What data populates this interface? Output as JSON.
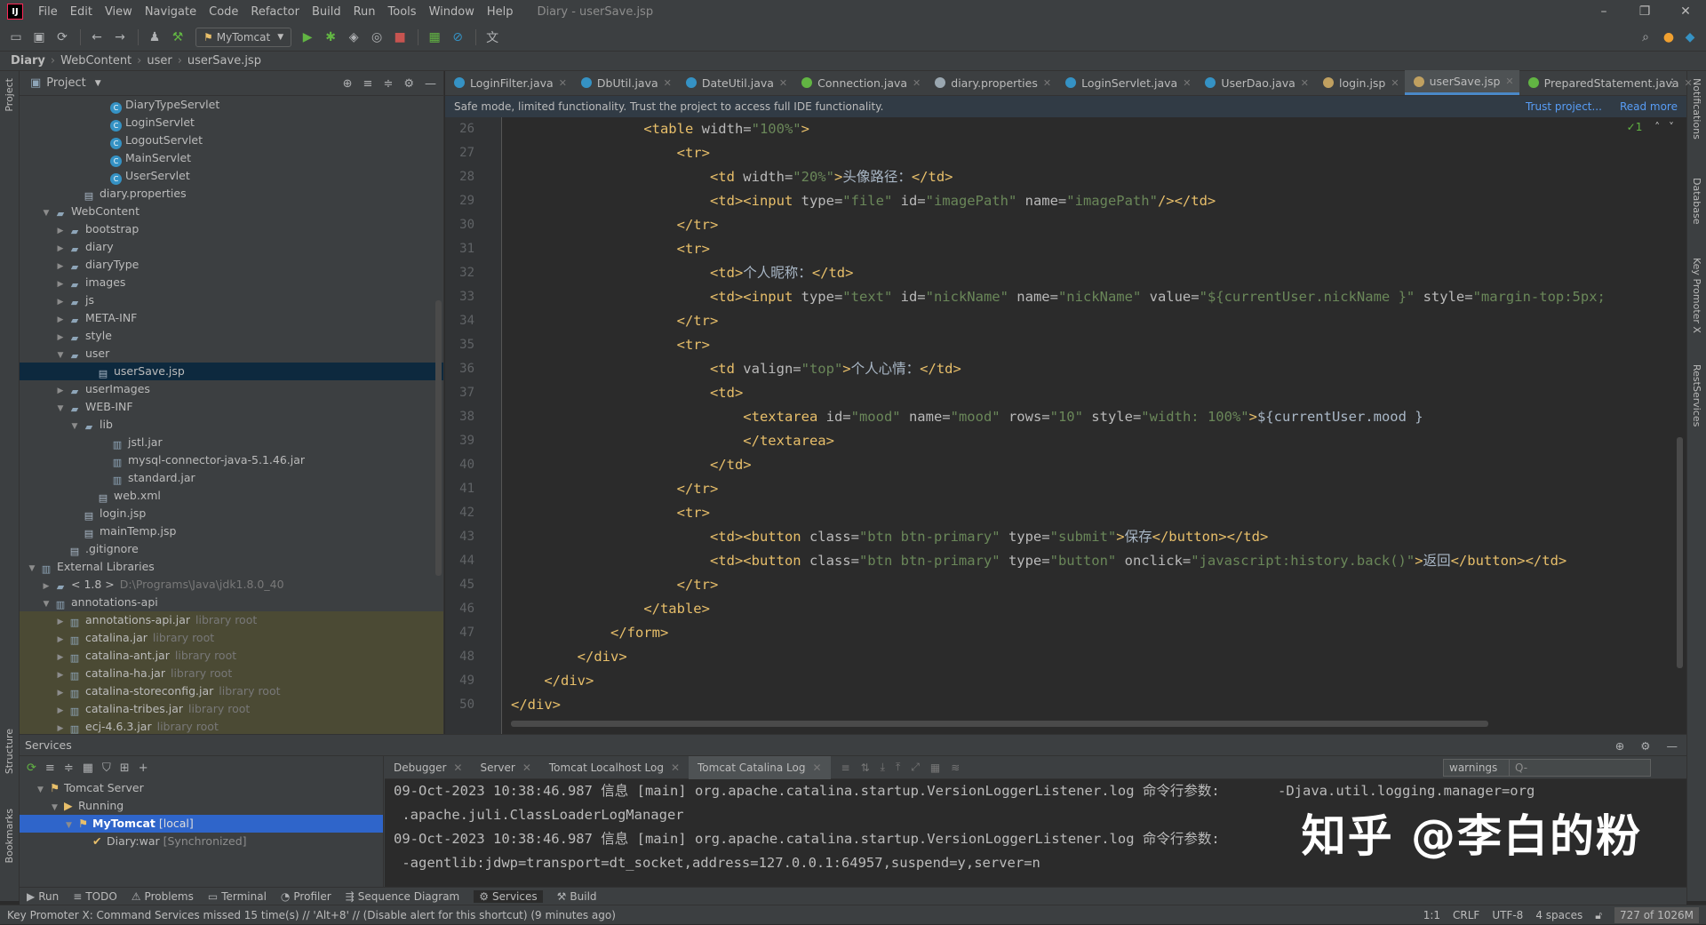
{
  "menubar": {
    "items": [
      "File",
      "Edit",
      "View",
      "Navigate",
      "Code",
      "Refactor",
      "Build",
      "Run",
      "Tools",
      "Window",
      "Help"
    ],
    "title": "Diary - userSave.jsp"
  },
  "toolbar": {
    "run_config": "MyTomcat"
  },
  "breadcrumb": [
    "Diary",
    "WebContent",
    "user",
    "userSave.jsp"
  ],
  "project": {
    "header": "Project",
    "tree": [
      {
        "indent": 5,
        "arrow": "",
        "icon": "cls",
        "label": "DiaryTypeServlet",
        "hint": ""
      },
      {
        "indent": 5,
        "arrow": "",
        "icon": "cls",
        "label": "LoginServlet",
        "hint": ""
      },
      {
        "indent": 5,
        "arrow": "",
        "icon": "cls",
        "label": "LogoutServlet",
        "hint": ""
      },
      {
        "indent": 5,
        "arrow": "",
        "icon": "cls",
        "label": "MainServlet",
        "hint": ""
      },
      {
        "indent": 5,
        "arrow": "",
        "icon": "cls",
        "label": "UserServlet",
        "hint": ""
      },
      {
        "indent": 3,
        "arrow": "",
        "icon": "file",
        "label": "diary.properties",
        "hint": ""
      },
      {
        "indent": 1,
        "arrow": "v",
        "icon": "fld",
        "label": "WebContent",
        "hint": ""
      },
      {
        "indent": 2,
        "arrow": ">",
        "icon": "fld",
        "label": "bootstrap",
        "hint": ""
      },
      {
        "indent": 2,
        "arrow": ">",
        "icon": "fld",
        "label": "diary",
        "hint": ""
      },
      {
        "indent": 2,
        "arrow": ">",
        "icon": "fld",
        "label": "diaryType",
        "hint": ""
      },
      {
        "indent": 2,
        "arrow": ">",
        "icon": "fld",
        "label": "images",
        "hint": ""
      },
      {
        "indent": 2,
        "arrow": ">",
        "icon": "fld",
        "label": "js",
        "hint": ""
      },
      {
        "indent": 2,
        "arrow": ">",
        "icon": "fld",
        "label": "META-INF",
        "hint": ""
      },
      {
        "indent": 2,
        "arrow": ">",
        "icon": "fld",
        "label": "style",
        "hint": ""
      },
      {
        "indent": 2,
        "arrow": "v",
        "icon": "fld",
        "label": "user",
        "hint": ""
      },
      {
        "indent": 4,
        "arrow": "",
        "icon": "file",
        "label": "userSave.jsp",
        "hint": "",
        "sel": true
      },
      {
        "indent": 2,
        "arrow": ">",
        "icon": "fld",
        "label": "userImages",
        "hint": ""
      },
      {
        "indent": 2,
        "arrow": "v",
        "icon": "fld",
        "label": "WEB-INF",
        "hint": ""
      },
      {
        "indent": 3,
        "arrow": "v",
        "icon": "fld",
        "label": "lib",
        "hint": ""
      },
      {
        "indent": 5,
        "arrow": "",
        "icon": "jar",
        "label": "jstl.jar",
        "hint": ""
      },
      {
        "indent": 5,
        "arrow": "",
        "icon": "jar",
        "label": "mysql-connector-java-5.1.46.jar",
        "hint": ""
      },
      {
        "indent": 5,
        "arrow": "",
        "icon": "jar",
        "label": "standard.jar",
        "hint": ""
      },
      {
        "indent": 4,
        "arrow": "",
        "icon": "file",
        "label": "web.xml",
        "hint": ""
      },
      {
        "indent": 3,
        "arrow": "",
        "icon": "file",
        "label": "login.jsp",
        "hint": ""
      },
      {
        "indent": 3,
        "arrow": "",
        "icon": "file",
        "label": "mainTemp.jsp",
        "hint": ""
      },
      {
        "indent": 2,
        "arrow": "",
        "icon": "file",
        "label": ".gitignore",
        "hint": ""
      },
      {
        "indent": 0,
        "arrow": "v",
        "icon": "jar",
        "label": "External Libraries",
        "hint": ""
      },
      {
        "indent": 1,
        "arrow": ">",
        "icon": "fld",
        "label": "< 1.8 >",
        "hint": "D:\\Programs\\Java\\jdk1.8.0_40"
      },
      {
        "indent": 1,
        "arrow": "v",
        "icon": "jar",
        "label": "annotations-api",
        "hint": ""
      },
      {
        "indent": 2,
        "arrow": ">",
        "icon": "jar",
        "label": "annotations-api.jar",
        "hint": "library root",
        "lib": true
      },
      {
        "indent": 2,
        "arrow": ">",
        "icon": "jar",
        "label": "catalina.jar",
        "hint": "library root",
        "lib": true
      },
      {
        "indent": 2,
        "arrow": ">",
        "icon": "jar",
        "label": "catalina-ant.jar",
        "hint": "library root",
        "lib": true
      },
      {
        "indent": 2,
        "arrow": ">",
        "icon": "jar",
        "label": "catalina-ha.jar",
        "hint": "library root",
        "lib": true
      },
      {
        "indent": 2,
        "arrow": ">",
        "icon": "jar",
        "label": "catalina-storeconfig.jar",
        "hint": "library root",
        "lib": true
      },
      {
        "indent": 2,
        "arrow": ">",
        "icon": "jar",
        "label": "catalina-tribes.jar",
        "hint": "library root",
        "lib": true
      },
      {
        "indent": 2,
        "arrow": ">",
        "icon": "jar",
        "label": "ecj-4.6.3.jar",
        "hint": "library root",
        "lib": true
      }
    ]
  },
  "tabs": [
    {
      "label": "LoginFilter.java",
      "color": "#3592c4"
    },
    {
      "label": "DbUtil.java",
      "color": "#3592c4"
    },
    {
      "label": "DateUtil.java",
      "color": "#3592c4"
    },
    {
      "label": "Connection.java",
      "color": "#62b543"
    },
    {
      "label": "diary.properties",
      "color": "#9aa7b0"
    },
    {
      "label": "LoginServlet.java",
      "color": "#3592c4"
    },
    {
      "label": "UserDao.java",
      "color": "#3592c4"
    },
    {
      "label": "login.jsp",
      "color": "#c0a060"
    },
    {
      "label": "userSave.jsp",
      "color": "#c0a060",
      "active": true
    },
    {
      "label": "PreparedStatement.java",
      "color": "#62b543"
    }
  ],
  "safe_mode": {
    "message": "Safe mode, limited functionality. Trust the project to access full IDE functionality.",
    "trust_link": "Trust project...",
    "read_more": "Read more"
  },
  "editor": {
    "inspection": "✓1",
    "lines": [
      {
        "n": "26",
        "tokens": [
          [
            "p",
            "                "
          ],
          [
            "t",
            "<table "
          ],
          [
            "a",
            "width="
          ],
          [
            "s",
            "\"100%\""
          ],
          [
            "t",
            ">"
          ]
        ]
      },
      {
        "n": "27",
        "tokens": [
          [
            "p",
            "                    "
          ],
          [
            "t",
            "<tr>"
          ]
        ]
      },
      {
        "n": "28",
        "tokens": [
          [
            "p",
            "                        "
          ],
          [
            "t",
            "<td "
          ],
          [
            "a",
            "width="
          ],
          [
            "s",
            "\"20%\""
          ],
          [
            "t",
            ">"
          ],
          [
            "p",
            "头像路径："
          ],
          [
            "t",
            "</td>"
          ]
        ]
      },
      {
        "n": "29",
        "tokens": [
          [
            "p",
            "                        "
          ],
          [
            "t",
            "<td><input "
          ],
          [
            "a",
            "type="
          ],
          [
            "s",
            "\"file\" "
          ],
          [
            "a",
            "id="
          ],
          [
            "s",
            "\"imagePath\" "
          ],
          [
            "a",
            "name="
          ],
          [
            "s",
            "\"imagePath\""
          ],
          [
            "t",
            "/></td>"
          ]
        ]
      },
      {
        "n": "30",
        "tokens": [
          [
            "p",
            "                    "
          ],
          [
            "t",
            "</tr>"
          ]
        ]
      },
      {
        "n": "31",
        "tokens": [
          [
            "p",
            "                    "
          ],
          [
            "t",
            "<tr>"
          ]
        ]
      },
      {
        "n": "32",
        "tokens": [
          [
            "p",
            "                        "
          ],
          [
            "t",
            "<td>"
          ],
          [
            "p",
            "个人昵称："
          ],
          [
            "t",
            "</td>"
          ]
        ]
      },
      {
        "n": "33",
        "tokens": [
          [
            "p",
            "                        "
          ],
          [
            "t",
            "<td><input "
          ],
          [
            "a",
            "type="
          ],
          [
            "s",
            "\"text\" "
          ],
          [
            "a",
            "id="
          ],
          [
            "s",
            "\"nickName\" "
          ],
          [
            "a",
            "name="
          ],
          [
            "s",
            "\"nickName\" "
          ],
          [
            "a",
            "value="
          ],
          [
            "s",
            "\"${currentUser.nickName }\" "
          ],
          [
            "a",
            "style="
          ],
          [
            "s",
            "\"margin-top:5px;"
          ]
        ]
      },
      {
        "n": "34",
        "tokens": [
          [
            "p",
            "                    "
          ],
          [
            "t",
            "</tr>"
          ]
        ]
      },
      {
        "n": "35",
        "tokens": [
          [
            "p",
            "                    "
          ],
          [
            "t",
            "<tr>"
          ]
        ]
      },
      {
        "n": "36",
        "tokens": [
          [
            "p",
            "                        "
          ],
          [
            "t",
            "<td "
          ],
          [
            "a",
            "valign="
          ],
          [
            "s",
            "\"top\""
          ],
          [
            "t",
            ">"
          ],
          [
            "p",
            "个人心情："
          ],
          [
            "t",
            "</td>"
          ]
        ]
      },
      {
        "n": "37",
        "tokens": [
          [
            "p",
            "                        "
          ],
          [
            "t",
            "<td>"
          ]
        ]
      },
      {
        "n": "38",
        "tokens": [
          [
            "p",
            "                            "
          ],
          [
            "t",
            "<textarea "
          ],
          [
            "a",
            "id="
          ],
          [
            "s",
            "\"mood\" "
          ],
          [
            "a",
            "name="
          ],
          [
            "s",
            "\"mood\" "
          ],
          [
            "a",
            "rows="
          ],
          [
            "s",
            "\"10\" "
          ],
          [
            "a",
            "style="
          ],
          [
            "s",
            "\"width: 100%\""
          ],
          [
            "t",
            ">"
          ],
          [
            "p",
            "${currentUser.mood }"
          ]
        ]
      },
      {
        "n": "39",
        "tokens": [
          [
            "p",
            "                            "
          ],
          [
            "t",
            "</textarea>"
          ]
        ]
      },
      {
        "n": "40",
        "tokens": [
          [
            "p",
            "                        "
          ],
          [
            "t",
            "</td>"
          ]
        ]
      },
      {
        "n": "41",
        "tokens": [
          [
            "p",
            "                    "
          ],
          [
            "t",
            "</tr>"
          ]
        ]
      },
      {
        "n": "42",
        "tokens": [
          [
            "p",
            "                    "
          ],
          [
            "t",
            "<tr>"
          ]
        ]
      },
      {
        "n": "43",
        "tokens": [
          [
            "p",
            "                        "
          ],
          [
            "t",
            "<td><button "
          ],
          [
            "a",
            "class="
          ],
          [
            "s",
            "\"btn btn-primary\" "
          ],
          [
            "a",
            "type="
          ],
          [
            "s",
            "\"submit\""
          ],
          [
            "t",
            ">"
          ],
          [
            "p",
            "保存"
          ],
          [
            "t",
            "</button></td>"
          ]
        ]
      },
      {
        "n": "44",
        "tokens": [
          [
            "p",
            "                        "
          ],
          [
            "t",
            "<td><button "
          ],
          [
            "a",
            "class="
          ],
          [
            "s",
            "\"btn btn-primary\" "
          ],
          [
            "a",
            "type="
          ],
          [
            "s",
            "\"button\" "
          ],
          [
            "a",
            "onclick="
          ],
          [
            "s",
            "\"javascript:history.back()\""
          ],
          [
            "t",
            ">"
          ],
          [
            "p",
            "返回"
          ],
          [
            "t",
            "</button></td>"
          ]
        ]
      },
      {
        "n": "45",
        "tokens": [
          [
            "p",
            "                    "
          ],
          [
            "t",
            "</tr>"
          ]
        ]
      },
      {
        "n": "46",
        "tokens": [
          [
            "p",
            "                "
          ],
          [
            "t",
            "</table>"
          ]
        ]
      },
      {
        "n": "47",
        "tokens": [
          [
            "p",
            "            "
          ],
          [
            "t",
            "</form>"
          ]
        ]
      },
      {
        "n": "48",
        "tokens": [
          [
            "p",
            "        "
          ],
          [
            "t",
            "</div>"
          ]
        ]
      },
      {
        "n": "49",
        "tokens": [
          [
            "p",
            "    "
          ],
          [
            "t",
            "</div>"
          ]
        ]
      },
      {
        "n": "50",
        "tokens": [
          [
            "t",
            "</div>"
          ]
        ]
      }
    ]
  },
  "services": {
    "header": "Services",
    "tree": [
      {
        "label": "Tomcat Server",
        "indent": 1,
        "arrow": "v"
      },
      {
        "label": "Running",
        "indent": 2,
        "arrow": "v"
      },
      {
        "label": "MyTomcat",
        "suffix": "[local]",
        "indent": 3,
        "arrow": "v",
        "sel": true
      },
      {
        "label": "Diary:war",
        "suffix": "[Synchronized]",
        "indent": 4,
        "arrow": ""
      }
    ],
    "tabs": [
      {
        "label": "Debugger"
      },
      {
        "label": "Server"
      },
      {
        "label": "Tomcat Localhost Log"
      },
      {
        "label": "Tomcat Catalina Log",
        "active": true
      }
    ],
    "filter": "warnings",
    "search_placeholder": "Q-",
    "log": [
      "09-Oct-2023 10:38:46.987 信息 [main] org.apache.catalina.startup.VersionLoggerListener.log 命令行参数:       -Djava.util.logging.manager=org",
      " .apache.juli.ClassLoaderLogManager",
      "09-Oct-2023 10:38:46.987 信息 [main] org.apache.catalina.startup.VersionLoggerListener.log 命令行参数:",
      " -agentlib:jdwp=transport=dt_socket,address=127.0.0.1:64957,suspend=y,server=n"
    ],
    "watermark": "知乎 @李白的粉"
  },
  "toolwindows": [
    "Run",
    "TODO",
    "Problems",
    "Terminal",
    "Profiler",
    "Sequence Diagram",
    "Services",
    "Build"
  ],
  "left_strip": [
    "Project",
    "Structure",
    "Bookmarks"
  ],
  "right_strip": [
    "Notifications",
    "Database",
    "Key Promoter X",
    "RestServices"
  ],
  "status": {
    "message": "Key Promoter X: Command Services missed 15 time(s) // 'Alt+8' // (Disable alert for this shortcut) (9 minutes ago)",
    "position": "1:1",
    "line_sep": "CRLF",
    "encoding": "UTF-8",
    "indent": "4 spaces",
    "memory": "727 of 1026M"
  }
}
